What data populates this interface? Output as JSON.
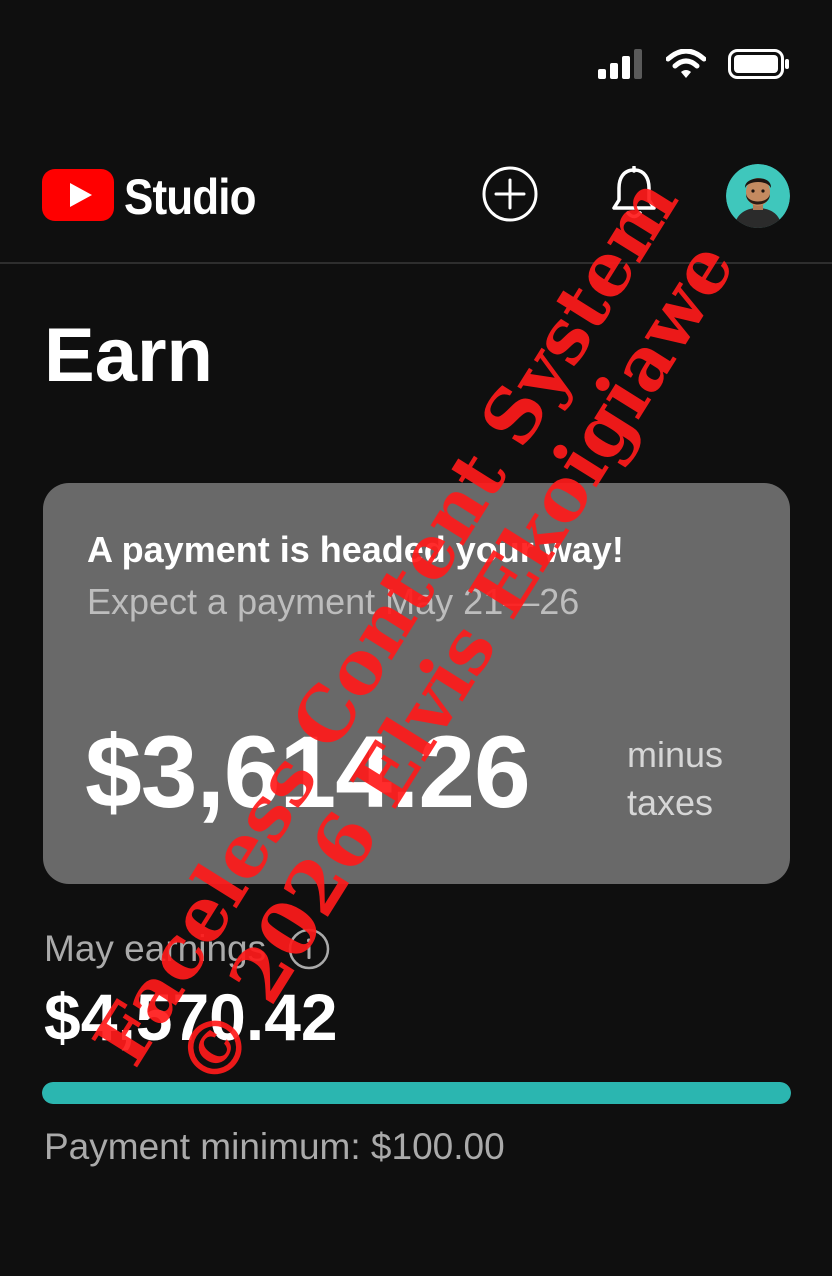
{
  "status_bar": {
    "icons": [
      "cellular-signal-icon",
      "wifi-icon",
      "battery-icon"
    ]
  },
  "header": {
    "logo_text": "Studio",
    "icons": [
      "youtube-play-icon",
      "create-plus-icon",
      "bell-icon",
      "avatar"
    ]
  },
  "page": {
    "title": "Earn"
  },
  "payment_card": {
    "heading": "A payment is headed your way!",
    "subtext": "Expect a payment May 21—26",
    "amount": "$3,614.26",
    "amount_suffix_line1": "minus",
    "amount_suffix_line2": "taxes"
  },
  "earnings": {
    "label": "May earnings",
    "value": "$4,570.42",
    "progress_fraction": 1.0,
    "payment_minimum": "Payment minimum: $100.00"
  },
  "watermark": {
    "line1": "Faceless Content System",
    "line2": "© 2026 Elvis Ekoigiawe"
  },
  "colors": {
    "background": "#0f0f0f",
    "card": "#696969",
    "progress": "#2bb6b0",
    "youtube_red": "#ff0000",
    "watermark_red": "#ff1a1a"
  }
}
